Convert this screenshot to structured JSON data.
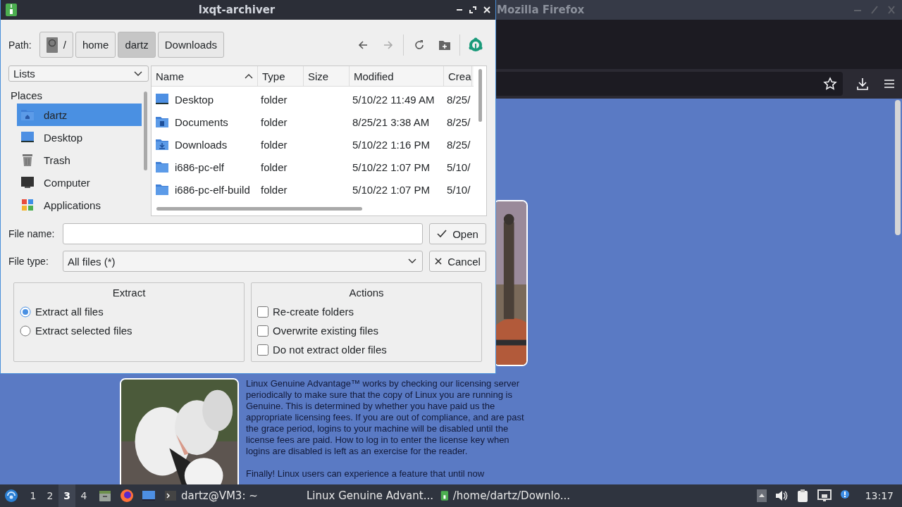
{
  "firefox": {
    "title": "Mozilla Firefox",
    "paragraphs": [
      "Linux Genuine Advantage™ works by checking our licensing server periodically to make sure that the copy of Linux you are running is Genuine. This is determined by whether you have paid us the appropriate licensing fees. If you are out of compliance, and are past the grace period, logins to your machine will be disabled until the license fees are paid. How to log in to enter the license key when logins are disabled is left as an exercise for the reader.",
      "Finally! Linux users can experience a feature that until now"
    ]
  },
  "dialog": {
    "title": "lxqt-archiver",
    "path_label": "Path:",
    "path": [
      {
        "label": "/",
        "kind": "root",
        "selected": false
      },
      {
        "label": "home",
        "kind": "dir",
        "selected": false
      },
      {
        "label": "dartz",
        "kind": "dir",
        "selected": true
      },
      {
        "label": "Downloads",
        "kind": "dir",
        "selected": false
      }
    ],
    "view_select": "Lists",
    "places_header": "Places",
    "places": [
      {
        "label": "dartz",
        "kind": "home",
        "selected": true
      },
      {
        "label": "Desktop",
        "kind": "desktop",
        "selected": false
      },
      {
        "label": "Trash",
        "kind": "trash",
        "selected": false
      },
      {
        "label": "Computer",
        "kind": "computer",
        "selected": false
      },
      {
        "label": "Applications",
        "kind": "applications",
        "selected": false
      }
    ],
    "columns": [
      "Name",
      "Type",
      "Modified",
      "Crea"
    ],
    "files": [
      {
        "name": "Desktop",
        "kind": "desktop",
        "type": "folder",
        "modified": "5/10/22 11:49 AM",
        "created": "8/25/"
      },
      {
        "name": "Documents",
        "kind": "documents",
        "type": "folder",
        "modified": "8/25/21 3:38 AM",
        "created": "8/25/"
      },
      {
        "name": "Downloads",
        "kind": "downloads",
        "type": "folder",
        "modified": "5/10/22 1:16 PM",
        "created": "8/25/"
      },
      {
        "name": "i686-pc-elf",
        "kind": "folder",
        "type": "folder",
        "modified": "5/10/22 1:07 PM",
        "created": "5/10/"
      },
      {
        "name": "i686-pc-elf-build",
        "kind": "folder",
        "type": "folder",
        "modified": "5/10/22 1:07 PM",
        "created": "5/10/"
      }
    ],
    "size_column": "Size",
    "file_name_label": "File name:",
    "file_type_label": "File type:",
    "file_type": "All files (*)",
    "open_button": "Open",
    "cancel_button": "Cancel",
    "extract": {
      "title": "Extract",
      "options": [
        {
          "label": "Extract all files",
          "selected": true
        },
        {
          "label": "Extract selected files",
          "selected": false
        }
      ]
    },
    "actions": {
      "title": "Actions",
      "options": [
        {
          "label": "Re-create folders",
          "checked": false
        },
        {
          "label": "Overwrite existing files",
          "checked": false
        },
        {
          "label": "Do not extract older files",
          "checked": false
        }
      ]
    }
  },
  "taskbar": {
    "desktops": [
      {
        "label": "1",
        "selected": false
      },
      {
        "label": "2",
        "selected": false
      },
      {
        "label": "3",
        "selected": true
      },
      {
        "label": "4",
        "selected": false
      }
    ],
    "tasks": [
      {
        "label": "dartz@VM3: ~",
        "kind": "terminal"
      },
      {
        "label": "Linux Genuine Advant...",
        "kind": "browser"
      },
      {
        "label": "/home/dartz/Downlo...",
        "kind": "archiver"
      }
    ],
    "clock": "13:17"
  }
}
